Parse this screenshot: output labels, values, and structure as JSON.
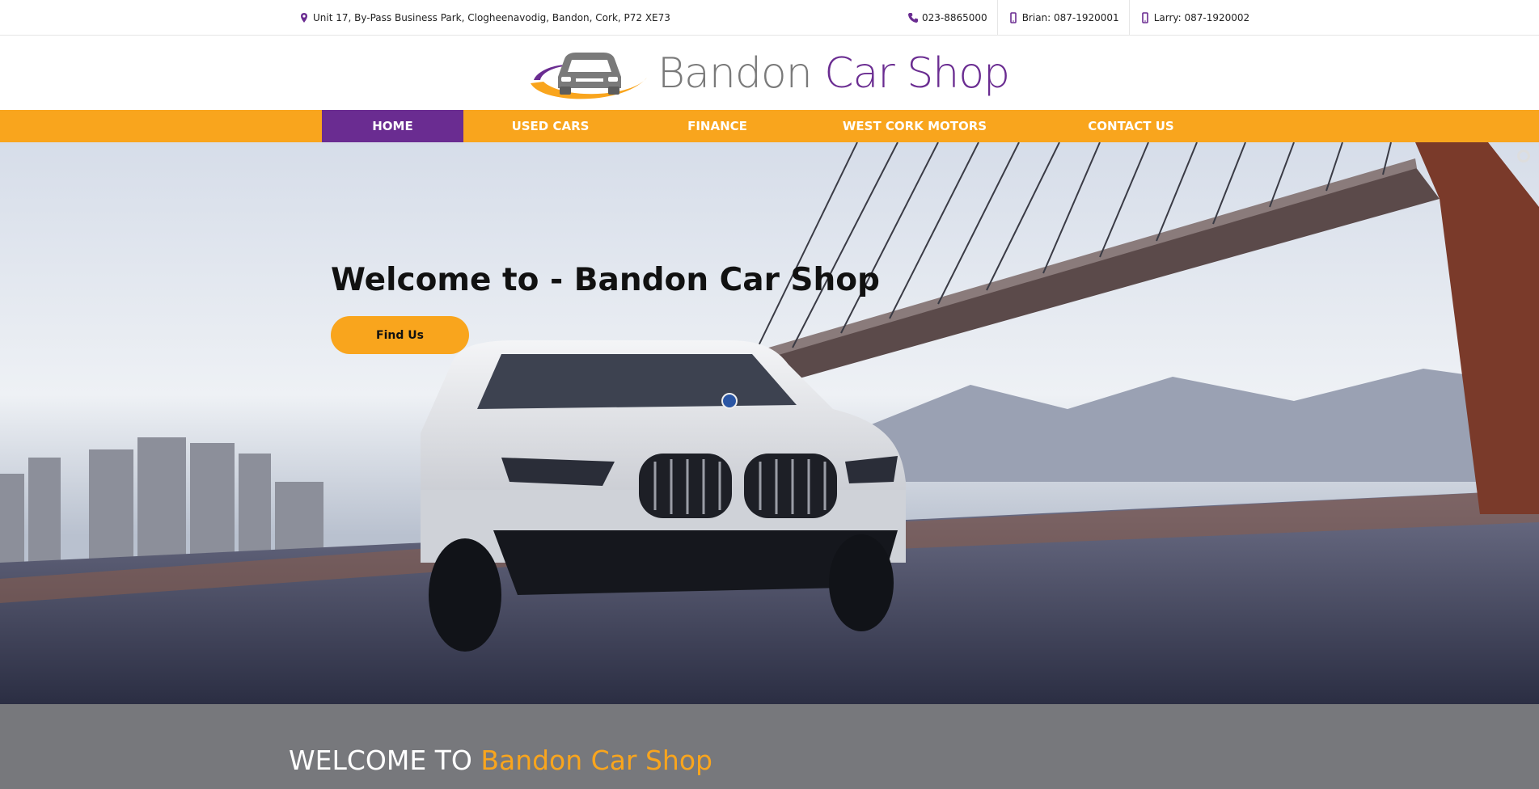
{
  "topbar": {
    "address": "Unit 17, By-Pass Business Park, Clogheenavodig, Bandon, Cork, P72 XE73",
    "phone": "023-8865000",
    "brian": "Brian: 087-1920001",
    "larry": "Larry: 087-1920002",
    "icons": [
      "map-pin-icon",
      "phone-icon",
      "mobile-icon",
      "mobile-icon"
    ]
  },
  "logo": {
    "word1": "Bandon",
    "word2": "Car Shop"
  },
  "nav": {
    "items": [
      "HOME",
      "USED CARS",
      "FINANCE",
      "WEST CORK MOTORS",
      "CONTACT US"
    ],
    "active": "HOME"
  },
  "hero": {
    "title": "Welcome to - Bandon Car Shop",
    "button": "Find Us"
  },
  "welcome": {
    "lead": "WELCOME TO",
    "brand": "Bandon Car Shop"
  },
  "colors": {
    "orange": "#f9a51d",
    "purple": "#6a2c91",
    "grey": "#77787c"
  }
}
